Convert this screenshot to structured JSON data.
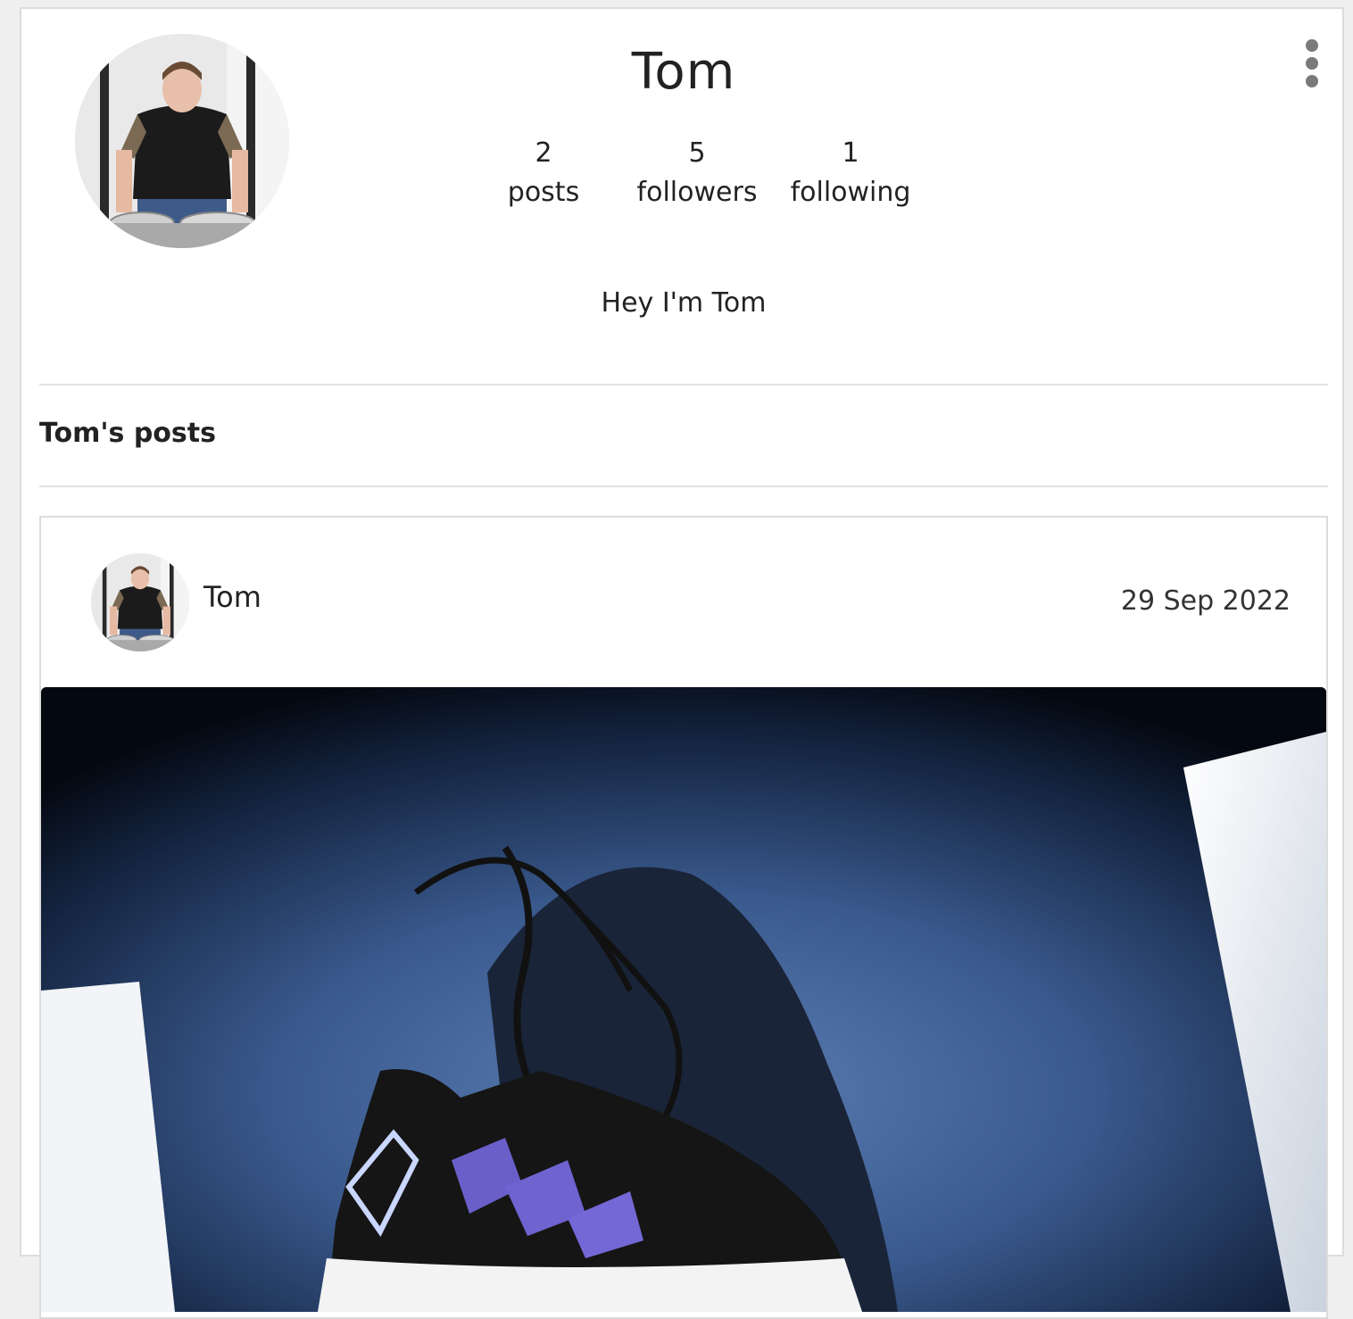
{
  "profile": {
    "name": "Tom",
    "bio": "Hey I'm Tom",
    "stats": [
      {
        "value": "2",
        "label": "posts"
      },
      {
        "value": "5",
        "label": "followers"
      },
      {
        "value": "1",
        "label": "following"
      }
    ],
    "menu_icon": "more-vertical-icon"
  },
  "posts_section": {
    "title": "Tom's posts"
  },
  "post": {
    "author": "Tom",
    "date": "29 Sep 2022"
  },
  "colors": {
    "background": "#efefef",
    "card": "#ffffff",
    "border": "#dcdcdc",
    "text": "#222222",
    "menu_dots": "#7a7a7a"
  }
}
